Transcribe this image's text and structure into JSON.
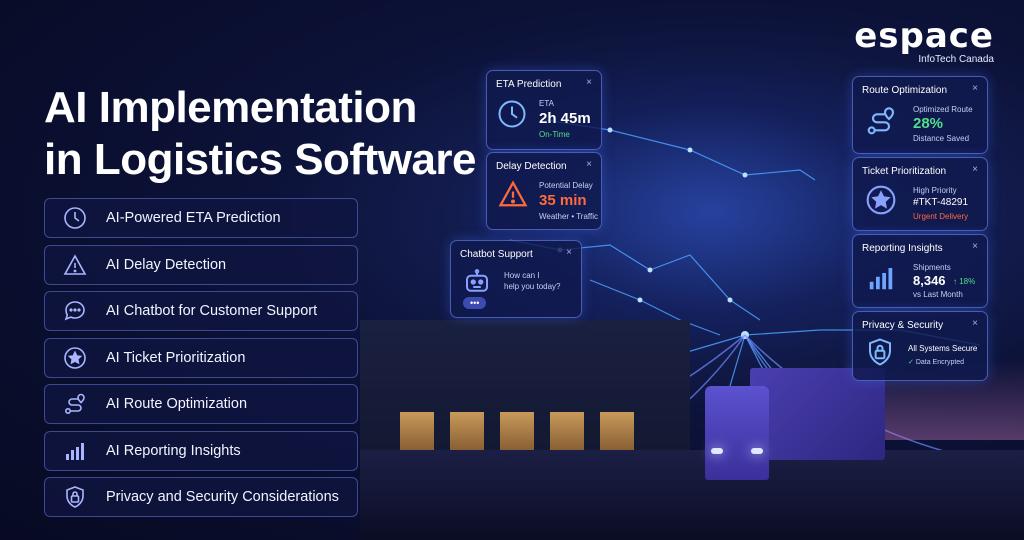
{
  "logo": {
    "word": "espace",
    "sub": "InfoTech Canada"
  },
  "title": {
    "line1": "AI Implementation",
    "line2": "in Logistics Software"
  },
  "features": [
    {
      "label": "AI-Powered ETA Prediction",
      "icon": "clock-icon"
    },
    {
      "label": "AI Delay Detection",
      "icon": "warning-icon"
    },
    {
      "label": "AI Chatbot for Customer Support",
      "icon": "chat-bubble-icon"
    },
    {
      "label": "AI Ticket Prioritization",
      "icon": "star-icon"
    },
    {
      "label": "AI Route Optimization",
      "icon": "route-icon"
    },
    {
      "label": "AI Reporting Insights",
      "icon": "bar-chart-icon"
    },
    {
      "label": "Privacy and Security Considerations",
      "icon": "lock-shield-icon"
    }
  ],
  "cards": {
    "eta": {
      "title": "ETA Prediction",
      "label": "ETA",
      "value": "2h 45m",
      "status": "On-Time",
      "close": "×"
    },
    "delay": {
      "title": "Delay Detection",
      "label": "Potential Delay",
      "value": "35 min",
      "note": "Weather • Traffic",
      "close": "×"
    },
    "chatbot": {
      "title": "Chatbot Support",
      "line1": "How can I",
      "line2": "help you today?",
      "typing": "•••",
      "close": "×"
    },
    "route": {
      "title": "Route Optimization",
      "label": "Optimized Route",
      "value": "28%",
      "note": "Distance Saved",
      "close": "×"
    },
    "ticket": {
      "title": "Ticket Prioritization",
      "label": "High Priority",
      "value": "#TKT-48291",
      "note": "Urgent Delivery",
      "close": "×"
    },
    "reporting": {
      "title": "Reporting Insights",
      "label": "Shipments",
      "value": "8,346",
      "change": "↑ 18%",
      "note": "vs Last Month",
      "close": "×"
    },
    "privacy": {
      "title": "Privacy & Security",
      "label": "All Systems Secure",
      "note": "Data Encrypted",
      "check": "✓",
      "close": "×"
    }
  },
  "colors": {
    "accent": "#7c8cff",
    "green": "#4fe08a",
    "orange": "#ff6a3d",
    "background": "#0c1238"
  }
}
